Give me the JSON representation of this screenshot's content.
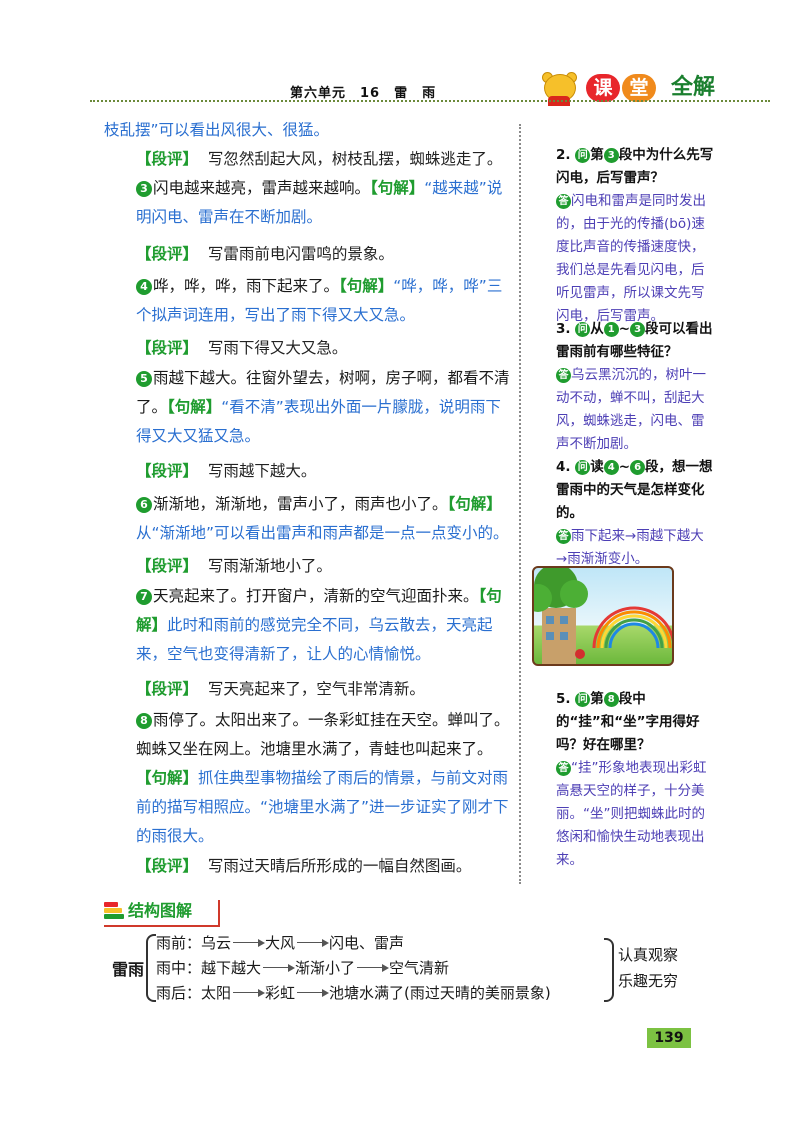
{
  "header": {
    "title": "第六单元　16　雷　雨",
    "logo": [
      "课",
      "堂",
      "全解"
    ]
  },
  "main": {
    "p0": {
      "blue": "枝乱摆”可以看出风很大、很猛。"
    },
    "p1": {
      "tag": "【段评】",
      "text": "写忽然刮起大风，树枝乱摆，蜘蛛逃走了。"
    },
    "p2": {
      "num": "3",
      "text": "闪电越来越亮，雷声越来越响。",
      "tag": "【句解】",
      "blue": "“越来越”说明闪电、雷声在不断加剧。"
    },
    "p3": {
      "tag": "【段评】",
      "text": "写雷雨前电闪雷鸣的景象。"
    },
    "p4": {
      "num": "4",
      "text": "哗，哗，哗，雨下起来了。",
      "tag": "【句解】",
      "blue": "“哗，哗，哗”三个拟声词连用，写出了雨下得又大又急。"
    },
    "p5": {
      "tag": "【段评】",
      "text": "写雨下得又大又急。"
    },
    "p6": {
      "num": "5",
      "text": "雨越下越大。往窗外望去，树啊，房子啊，都看不清了。",
      "tag": "【句解】",
      "blue": "“看不清”表现出外面一片朦胧，说明雨下得又大又猛又急。"
    },
    "p7": {
      "tag": "【段评】",
      "text": "写雨越下越大。"
    },
    "p8": {
      "num": "6",
      "text": "渐渐地，渐渐地，雷声小了，雨声也小了。",
      "tag": "【句解】",
      "blue": "从“渐渐地”可以看出雷声和雨声都是一点一点变小的。"
    },
    "p9": {
      "tag": "【段评】",
      "text": "写雨渐渐地小了。"
    },
    "p10": {
      "num": "7",
      "text": "天亮起来了。打开窗户，清新的空气迎面扑来。",
      "tag": "【句解】",
      "blue": "此时和雨前的感觉完全不同，乌云散去，天亮起来，空气也变得清新了，让人的心情愉悦。"
    },
    "p11": {
      "tag": "【段评】",
      "text": "写天亮起来了，空气非常清新。"
    },
    "p12": {
      "num": "8",
      "text": "雨停了。太阳出来了。一条彩虹挂在天空。蝉叫了。蜘蛛又坐在网上。池塘里水满了，青蛙也叫起来了。",
      "tag": "【句解】",
      "blue": "抓住典型事物描绘了雨后的情景，与前文对雨前的描写相照应。“池塘里水满了”进一步证实了刚才下的雨很大。"
    },
    "p13": {
      "tag": "【段评】",
      "text": "写雨过天晴后所形成的一幅自然图画。"
    }
  },
  "side": {
    "q2": {
      "pre": "2.",
      "ask": "问",
      "a": "第",
      "num": "3",
      "b": "段中为什么先写闪电，后写雷声？",
      "ans": "答",
      "answer": "闪电和雷声是同时发出的，由于光的传播(bō)速度比声音的传播速度快，我们总是先看见闪电，后听见雷声，所以课文先写闪电，后写雷声。"
    },
    "q3": {
      "pre": "3.",
      "ask": "问",
      "a": "从",
      "num1": "1",
      "tilde": "~",
      "num2": "3",
      "b": "段可以看出雷雨前有哪些特征？",
      "ans": "答",
      "answer": "乌云黑沉沉的，树叶一动不动，蝉不叫，刮起大风，蜘蛛逃走，闪电、雷声不断加剧。"
    },
    "q4": {
      "pre": "4.",
      "ask": "问",
      "a": "读",
      "num1": "4",
      "tilde": "~",
      "num2": "6",
      "b": "段，想一想雷雨中的天气是怎样变化的。",
      "ans": "答",
      "answer": "雨下起来→雨越下越大→雨渐渐变小。"
    },
    "q5": {
      "pre": "5.",
      "ask": "问",
      "a": "第",
      "num": "8",
      "b": "段中的“挂”和“坐”字用得好吗？好在哪里？",
      "ans": "答",
      "answer": "“挂”形象地表现出彩虹高悬天空的样子，十分美丽。“坐”则把蜘蛛此时的悠闲和愉快生动地表现出来。"
    }
  },
  "structure": {
    "title": "结构图解",
    "root": "雷雨",
    "rows": [
      [
        "雨前：乌云",
        "大风",
        "闪电、雷声"
      ],
      [
        "雨中：越下越大",
        "渐渐小了",
        "空气清新"
      ],
      [
        "雨后：太阳",
        "彩虹",
        "池塘水满了(雨过天晴的美丽景象)"
      ]
    ],
    "right": [
      "认真观察",
      "乐趣无穷"
    ]
  },
  "page_number": "139"
}
